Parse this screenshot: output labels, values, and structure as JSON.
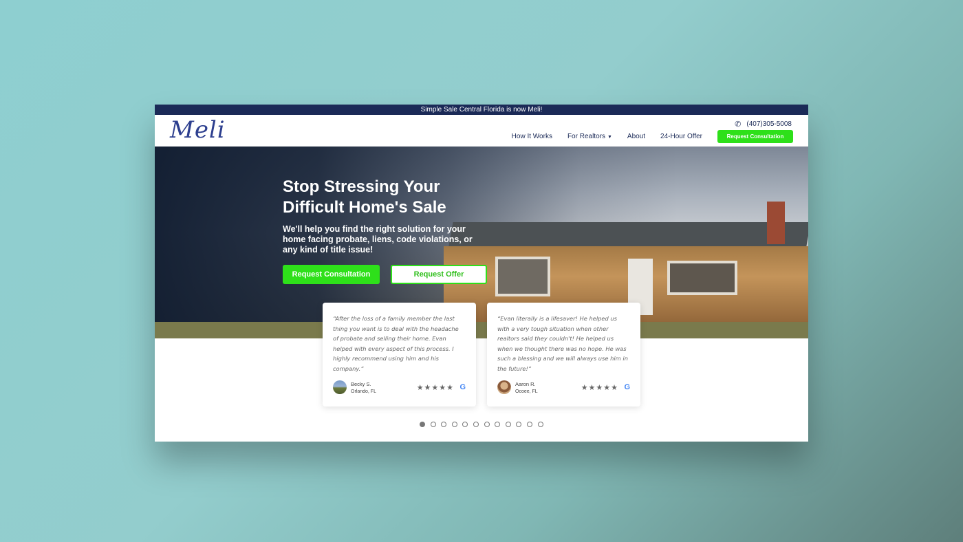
{
  "announcement": "Simple Sale Central Florida is now Meli!",
  "logo_text": "Meli",
  "phone": {
    "icon": "phone-icon",
    "number": "(407)305-5008"
  },
  "nav": {
    "items": [
      {
        "label": "How It Works"
      },
      {
        "label": "For Realtors",
        "has_dropdown": true
      },
      {
        "label": "About"
      },
      {
        "label": "24-Hour Offer"
      }
    ],
    "cta": "Request Consultation"
  },
  "hero": {
    "title_line1": "Stop Stressing Your",
    "title_line2": "Difficult Home's Sale",
    "subtitle": "We'll help you find the right solution for your home facing probate, liens, code violations, or any kind of title issue!",
    "primary_button": "Request Consultation",
    "secondary_button": "Request Offer"
  },
  "testimonials": [
    {
      "quote": "“After the loss of a family member the last thing you want is to deal with the headache of probate and selling their home. Evan helped with every aspect of this process. I highly recommend using him and his company.”",
      "name": "Becky S.",
      "location": "Orlando, FL",
      "stars": "★★★★★",
      "rating": 5
    },
    {
      "quote": "“Evan literally is a lifesaver! He helped us with a very tough situation when other realtors said they couldn't! He helped us when we thought there was no hope. He was such a blessing and we will always use him in the future!”",
      "name": "Aaron R.",
      "location": "Ocoee, FL",
      "stars": "★★★★★",
      "rating": 5
    }
  ],
  "google_icon": "G",
  "carousel": {
    "total_slides": 12,
    "active_index": 0
  },
  "colors": {
    "brand_navy": "#1b2a57",
    "cta_green": "#2ee01a",
    "logo_blue": "#2d3f8f"
  }
}
